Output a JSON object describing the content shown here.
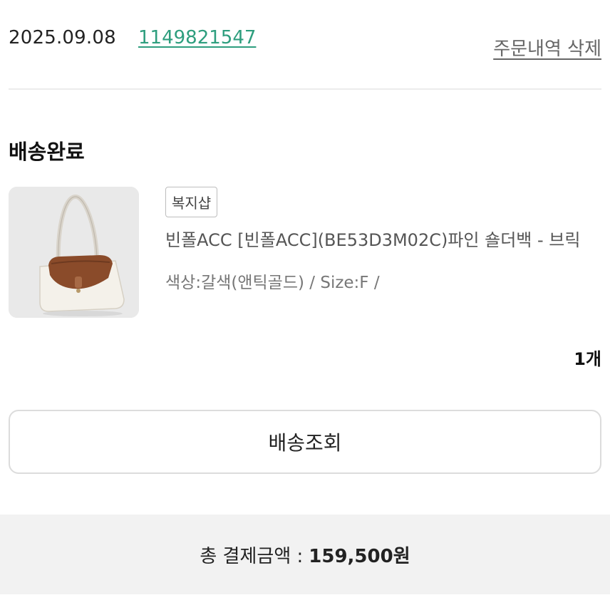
{
  "order": {
    "date": "2025.09.08",
    "number": "1149821547",
    "delete_label": "주문내역 삭제"
  },
  "status": "배송완료",
  "product": {
    "brand_badge": "복지샵",
    "name": "빈폴ACC [빈폴ACC](BE53D3M02C)파인 숄더백 - 브릭",
    "options": "색상:갈색(앤틱골드) / Size:F /",
    "quantity": "1개",
    "image_icon": "shoulder-bag-icon"
  },
  "actions": {
    "track_label": "배송조회"
  },
  "summary": {
    "label": "총 결제금액 :",
    "amount": "159,500원"
  },
  "colors": {
    "link_green": "#2e9e7e",
    "bag_brown": "#8a4b2a",
    "bag_body": "#f4f1ea",
    "summary_bg": "#f2f2f2"
  }
}
